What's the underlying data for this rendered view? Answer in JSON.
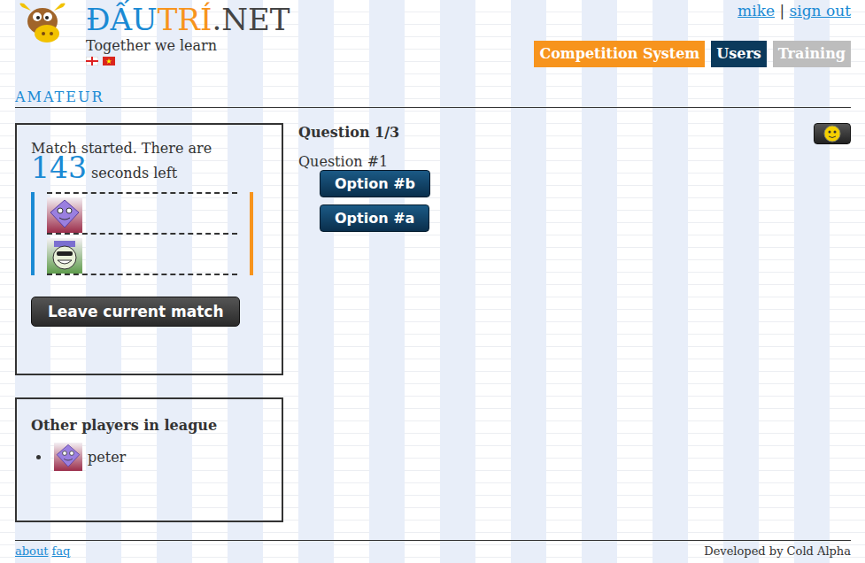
{
  "site": {
    "title_parts": [
      {
        "text": "ĐẤU",
        "color": "#1a8ad4"
      },
      {
        "text": "TRÍ",
        "color": "#f7941d"
      },
      {
        "text": ".NET",
        "color": "#444444"
      }
    ],
    "tagline": "Together we learn"
  },
  "account": {
    "user": "mike",
    "separator": "|",
    "sign_out": "sign out"
  },
  "nav": [
    {
      "label": "Competition System",
      "color": "#f7941d"
    },
    {
      "label": "Users",
      "color": "#0b3a5c"
    },
    {
      "label": "Training",
      "color": "#bdbdbd"
    }
  ],
  "league": "AMATEUR",
  "match": {
    "status_before": "Match started. There are",
    "seconds": "143",
    "status_after": "seconds left",
    "players": [
      {
        "kind": "diamond",
        "color": "#9b2d4a"
      },
      {
        "kind": "smiley",
        "color": "#5f9c4c"
      }
    ],
    "leave_button": "Leave current match"
  },
  "other_players": {
    "title": "Other players in league",
    "players": [
      {
        "name": "peter",
        "kind": "diamond",
        "color": "#9b2d4a"
      }
    ]
  },
  "question": {
    "counter": "Question 1/3",
    "text": "Question #1",
    "options": [
      "Option #b",
      "Option #a"
    ]
  },
  "footer": {
    "links": [
      "about",
      "faq"
    ],
    "credit": "Developed by Cold Alpha"
  }
}
